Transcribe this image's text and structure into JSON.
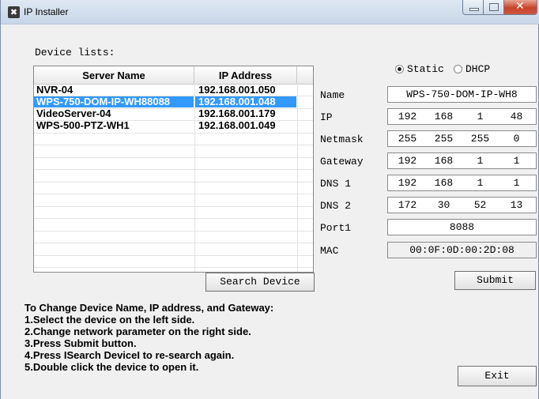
{
  "window": {
    "title": "IP Installer"
  },
  "device_list": {
    "label": "Device lists:",
    "columns": [
      "Server Name",
      "IP Address"
    ],
    "rows": [
      {
        "name": "NVR-04",
        "ip": "192.168.001.050",
        "selected": false
      },
      {
        "name": "WPS-750-DOM-IP-WH88088",
        "ip": "192.168.001.048",
        "selected": true
      },
      {
        "name": "VideoServer-04",
        "ip": "192.168.001.179",
        "selected": false
      },
      {
        "name": "WPS-500-PTZ-WH1",
        "ip": "192.168.001.049",
        "selected": false
      }
    ]
  },
  "buttons": {
    "search": "Search Device",
    "submit": "Submit",
    "exit": "Exit"
  },
  "mode": {
    "static_label": "Static",
    "dhcp_label": "DHCP",
    "selected": "Static"
  },
  "fields": {
    "name": {
      "label": "Name",
      "value": "WPS-750-DOM-IP-WH8"
    },
    "ip": {
      "label": "IP",
      "octets": [
        "192",
        "168",
        "1",
        "48"
      ]
    },
    "netmask": {
      "label": "Netmask",
      "octets": [
        "255",
        "255",
        "255",
        "0"
      ]
    },
    "gateway": {
      "label": "Gateway",
      "octets": [
        "192",
        "168",
        "1",
        "1"
      ]
    },
    "dns1": {
      "label": "DNS 1",
      "octets": [
        "192",
        "168",
        "1",
        "1"
      ]
    },
    "dns2": {
      "label": "DNS 2",
      "octets": [
        "172",
        "30",
        "52",
        "13"
      ]
    },
    "port1": {
      "label": "Port1",
      "value": "8088"
    },
    "mac": {
      "label": "MAC",
      "value": "00:0F:0D:00:2D:08"
    }
  },
  "instructions": [
    "To Change Device Name, IP address, and Gateway:",
    "1.Select the device on the left side.",
    "2.Change network parameter on the right side.",
    "3.Press Submit button.",
    "4.Press ISearch DeviceI to re-search again.",
    "5.Double click the device to open it."
  ]
}
